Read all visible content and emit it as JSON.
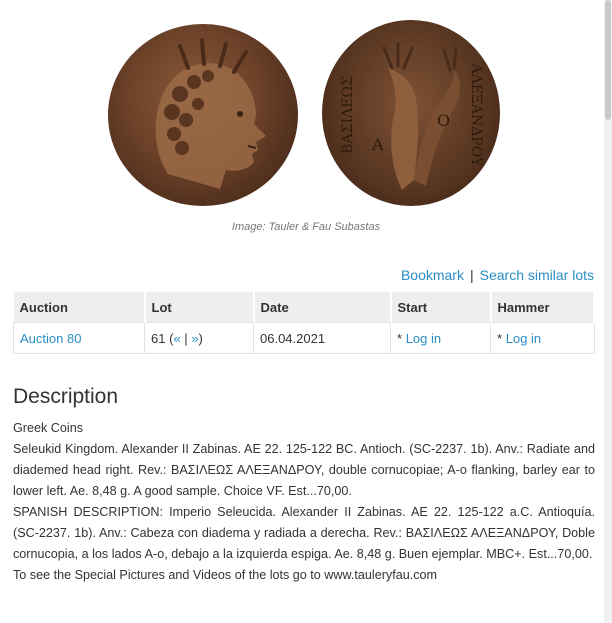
{
  "image_caption": "Image: Tauler & Fau Subastas",
  "reverse_inscriptions": {
    "left": "ΒΑΣΙΛΕΩΣ",
    "right": "ΑΛΕΞΑΝΔΡΟΥ",
    "monogram_a": "Α",
    "monogram_o": "Ο"
  },
  "links": {
    "bookmark": "Bookmark",
    "separator": "|",
    "search_similar": "Search similar lots"
  },
  "table": {
    "headers": [
      "Auction",
      "Lot",
      "Date",
      "Start",
      "Hammer"
    ],
    "row": {
      "auction": "Auction 80",
      "lot_number": "61",
      "lot_open": "(",
      "prev": "«",
      "pipe": "|",
      "next": "»",
      "lot_close": ")",
      "date": "06.04.2021",
      "start_prefix": "*",
      "start_link": "Log in",
      "hammer_prefix": "*",
      "hammer_link": "Log in"
    }
  },
  "description": {
    "title": "Description",
    "category": "Greek Coins",
    "english": "Seleukid Kingdom. Alexander II Zabinas. AE 22. 125-122 BC. Antioch. (SC-2237. 1b). Anv.: Radiate and diademed head right. Rev.: ΒΑΣΙΛΕΩΣ ΑΛΕΞΑΝΔΡΟΥ, double cornucopiae; A-o flanking, barley ear to lower left. Ae. 8,48 g. A good sample. Choice VF. Est...70,00.",
    "spanish": "SPANISH DESCRIPTION: Imperio Seleucida. Alexander II Zabinas. AE 22. 125-122 a.C. Antioquía. (SC-2237. 1b). Anv.: Cabeza con diadema y radiada a derecha. Rev.: ΒΑΣΙΛΕΩΣ ΑΛΕΞΑΝΔΡΟΥ, Doble cornucopia, a los lados A-o, debajo a la izquierda espiga. Ae. 8,48 g. Buen ejemplar. MBC+. Est...70,00.",
    "footer": "To see the Special Pictures and Videos of the lots go to www.tauleryfau.com"
  }
}
